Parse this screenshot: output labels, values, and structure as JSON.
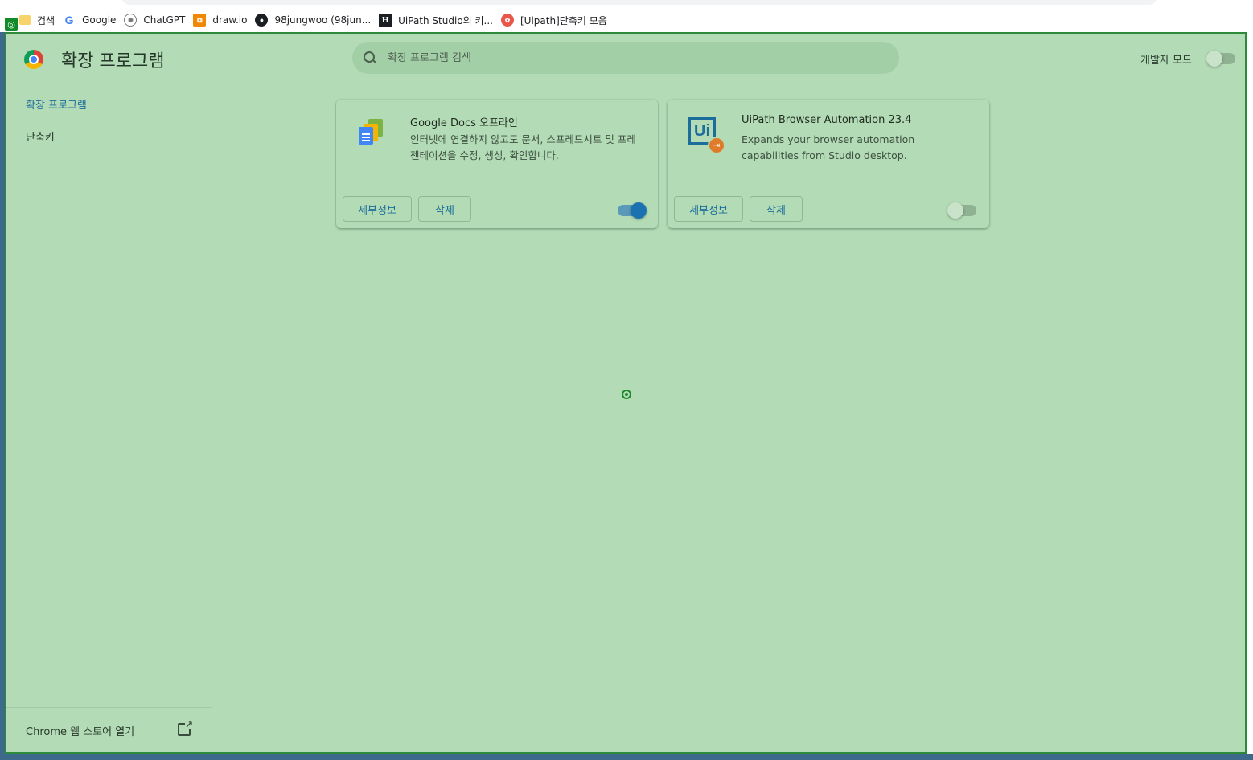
{
  "bookmarks": [
    {
      "label": "검색",
      "icon": "folder-icon"
    },
    {
      "label": "Google",
      "icon": "google-icon"
    },
    {
      "label": "ChatGPT",
      "icon": "chatgpt-icon"
    },
    {
      "label": "draw.io",
      "icon": "drawio-icon"
    },
    {
      "label": "98jungwoo (98jun...",
      "icon": "github-icon"
    },
    {
      "label": "UiPath Studio의 키...",
      "icon": "hashnode-icon"
    },
    {
      "label": "[Uipath]단축키 모음",
      "icon": "uipath-bookmark-icon"
    }
  ],
  "header": {
    "title": "확장 프로그램",
    "search_placeholder": "확장 프로그램 검색",
    "devmode_label": "개발자 모드",
    "devmode_on": false
  },
  "sidebar": {
    "items": [
      {
        "label": "확장 프로그램",
        "active": true
      },
      {
        "label": "단축키",
        "active": false
      }
    ],
    "store_link": "Chrome 웹 스토어 열기"
  },
  "extensions": [
    {
      "name": "Google Docs 오프라인",
      "description": "인터넷에 연결하지 않고도 문서, 스프레드시트 및 프레젠테이션을 수정, 생성, 확인합니다.",
      "details_label": "세부정보",
      "remove_label": "삭제",
      "enabled": true,
      "icon": "google-docs-icon"
    },
    {
      "name": "UiPath Browser Automation 23.4",
      "description": "Expands your browser automation capabilities from Studio desktop.",
      "details_label": "세부정보",
      "remove_label": "삭제",
      "enabled": false,
      "icon": "uipath-icon",
      "icon_text": "Ui"
    }
  ],
  "colors": {
    "overlay": "#b3dcb6",
    "accent": "#1c6d9c",
    "border": "#2d8a3a"
  }
}
